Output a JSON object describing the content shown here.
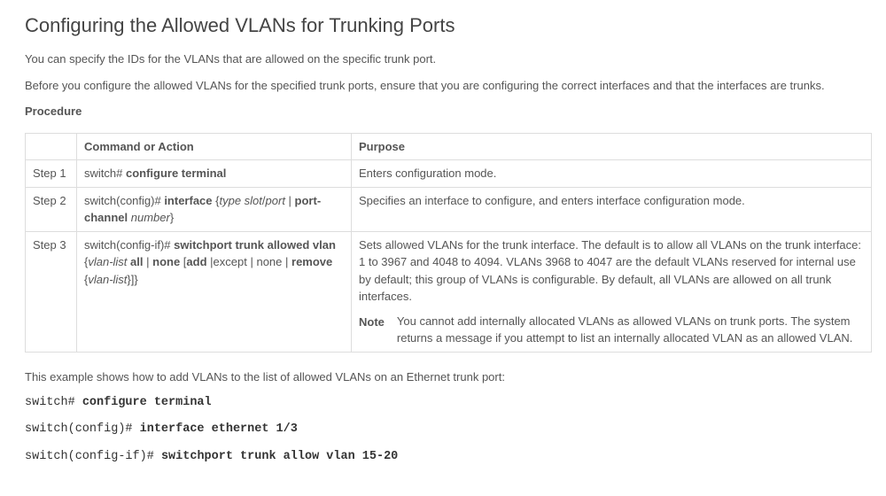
{
  "title": "Configuring the Allowed VLANs for Trunking Ports",
  "intro1": "You can specify the IDs for the VLANs that are allowed on the specific trunk port.",
  "intro2": "Before you configure the allowed VLANs for the specified trunk ports, ensure that you are configuring the correct interfaces and that the interfaces are trunks.",
  "procedure_label": "Procedure",
  "table": {
    "headers": {
      "cmd": "Command or Action",
      "purpose": "Purpose"
    },
    "rows": [
      {
        "step": "Step 1",
        "cmd_prefix": "switch# ",
        "cmd_bold": "configure terminal",
        "purpose": "Enters configuration mode."
      },
      {
        "step": "Step 2",
        "cmd_prefix": "switch(config)# ",
        "cmd_bold": "interface",
        "cmd_tail_open": " {",
        "cmd_ital1": "type slot",
        "cmd_sep": "/",
        "cmd_ital2": "port",
        "cmd_tail_mid": " | ",
        "cmd_bold2": "port-channel",
        "cmd_tail_sp": " ",
        "cmd_ital3": "number",
        "cmd_tail_close": "}",
        "purpose": "Specifies an interface to configure, and enters interface configuration mode."
      },
      {
        "step": "Step 3",
        "cmd_prefix": "switch(config-if)# ",
        "cmd_bold": "switchport trunk allowed vlan",
        "cmd_tail_open": " {",
        "cmd_ital1": "vlan-list",
        "cmd_sp1": " ",
        "cmd_bold_all": "all",
        "cmd_pipe1": " | ",
        "cmd_bold_none": "none",
        "cmd_sq_open": " [",
        "cmd_bold_add": "add",
        "cmd_pipe2": " |",
        "cmd_except": "except ",
        "cmd_pipe3": "| ",
        "cmd_none2": "none ",
        "cmd_pipe4": "| ",
        "cmd_bold_remove": "remove",
        "cmd_sp2": " {",
        "cmd_ital2": "vlan-list",
        "cmd_close": "}]}",
        "purpose": "Sets allowed VLANs for the trunk interface. The default is to allow all VLANs on the trunk interface: 1 to 3967 and 4048 to 4094. VLANs 3968 to 4047 are the default VLANs reserved for internal use by default; this group of VLANs is configurable. By default, all VLANs are allowed on all trunk interfaces.",
        "note_label": "Note",
        "note_text": "You cannot add internally allocated VLANs as allowed VLANs on trunk ports. The system returns a message if you attempt to list an internally allocated VLAN as an allowed VLAN."
      }
    ]
  },
  "example_intro": "This example shows how to add VLANs to the list of allowed VLANs on an Ethernet trunk port:",
  "cli": [
    {
      "prompt": "switch# ",
      "cmd": "configure terminal"
    },
    {
      "prompt": "switch(config)# ",
      "cmd": "interface ethernet 1/3"
    },
    {
      "prompt": "switch(config-if)# ",
      "cmd": "switchport trunk allow vlan 15-20"
    }
  ]
}
